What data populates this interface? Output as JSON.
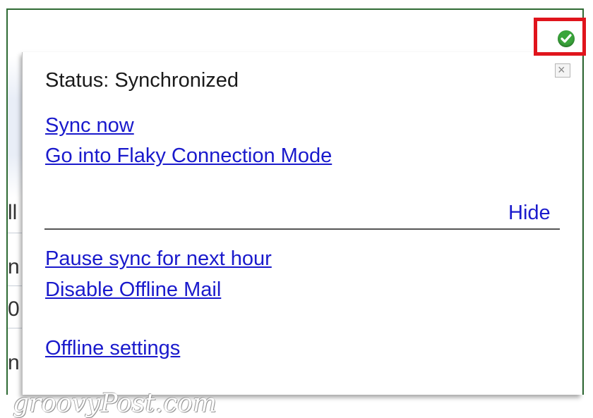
{
  "popup": {
    "status_text": "Status: Synchronized",
    "close_glyph": "×",
    "links_top": {
      "sync_now": "Sync now",
      "flaky_mode": "Go into Flaky Connection Mode"
    },
    "hide_label": "Hide",
    "links_bottom": {
      "pause_sync": "Pause sync for next hour",
      "disable_offline": "Disable Offline Mail",
      "offline_settings": "Offline settings"
    }
  },
  "background": {
    "truncated_chars": [
      "ll",
      "n",
      "0",
      "n"
    ]
  },
  "status_indicator": {
    "icon": "check-circle-icon",
    "color": "#3aa53b",
    "highlight_color": "#e0141c"
  },
  "watermark": "groovyPost.com"
}
